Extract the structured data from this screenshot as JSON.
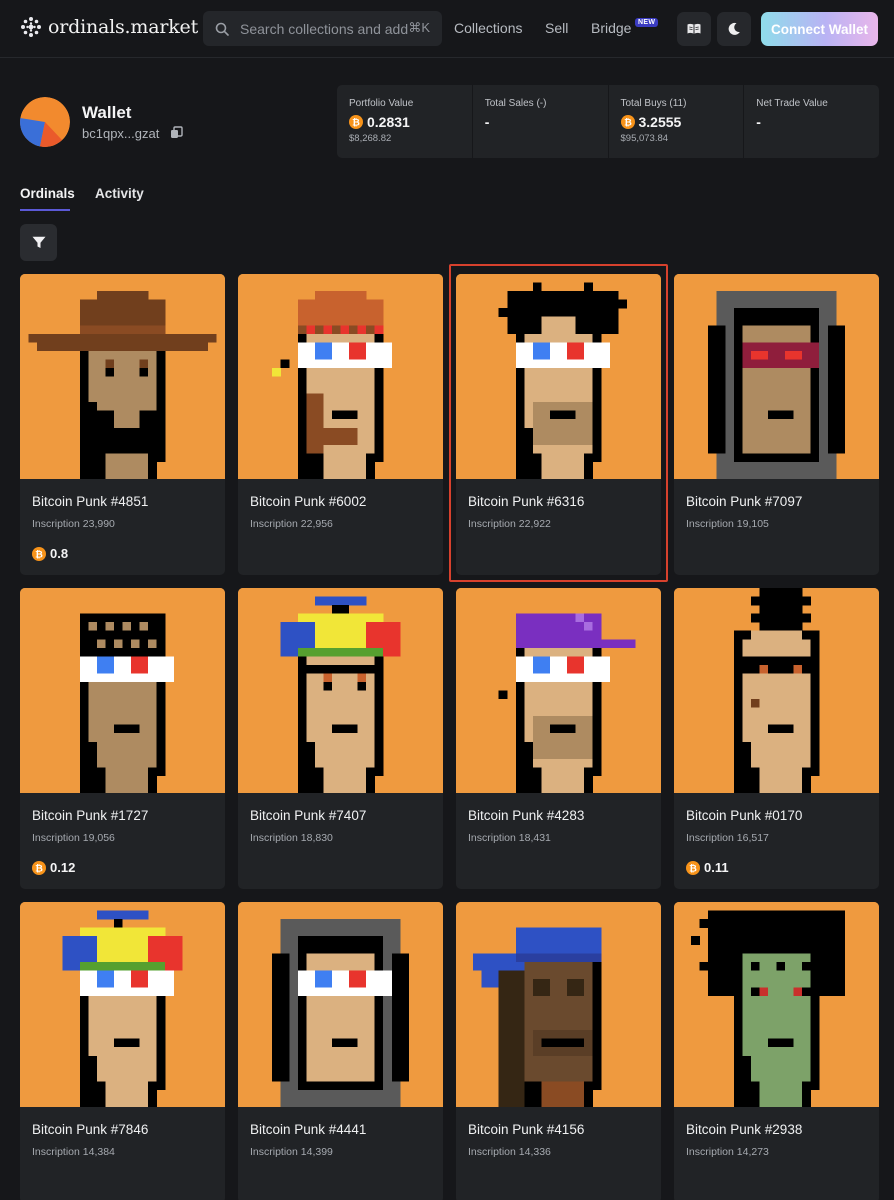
{
  "header": {
    "logo_text": "ordinals.market",
    "search_placeholder": "Search collections and addresses",
    "search_shortcut": "⌘K",
    "nav": [
      "Collections",
      "Sell",
      "Bridge"
    ],
    "bridge_badge": "NEW",
    "connect_label": "Connect Wallet"
  },
  "wallet": {
    "title": "Wallet",
    "address": "bc1qpx...gzat"
  },
  "stats": [
    {
      "label": "Portfolio Value",
      "value": "0.2831",
      "sub": "$8,268.82",
      "btc": true
    },
    {
      "label": "Total Sales (-)",
      "value": "-",
      "sub": "",
      "btc": false
    },
    {
      "label": "Total Buys (11)",
      "value": "3.2555",
      "sub": "$95,073.84",
      "btc": true
    },
    {
      "label": "Net Trade Value",
      "value": "-",
      "sub": "",
      "btc": false
    }
  ],
  "tabs": [
    "Ordinals",
    "Activity"
  ],
  "colors": {
    "accent": "#5b59d6",
    "card_bg": "#ef9a3f",
    "bitcoin": "#f7931a",
    "highlight": "#d7412d"
  },
  "cards": [
    {
      "name": "Bitcoin Punk #4851",
      "inscription": "Inscription 23,990",
      "price": "0.8",
      "icon": "punk-cowboy-hat-icon"
    },
    {
      "name": "Bitcoin Punk #6002",
      "inscription": "Inscription 22,956",
      "price": "",
      "icon": "punk-3d-glasses-red-hat-icon"
    },
    {
      "name": "Bitcoin Punk #6316",
      "inscription": "Inscription 22,922",
      "price": "",
      "icon": "punk-3d-glasses-messy-hair-icon"
    },
    {
      "name": "Bitcoin Punk #7097",
      "inscription": "Inscription 19,105",
      "price": "",
      "icon": "punk-hoodie-vr-icon"
    },
    {
      "name": "Bitcoin Punk #1727",
      "inscription": "Inscription 19,056",
      "price": "0.12",
      "icon": "punk-3d-glasses-hair-icon"
    },
    {
      "name": "Bitcoin Punk #7407",
      "inscription": "Inscription 18,830",
      "price": "",
      "icon": "punk-propeller-cap-icon"
    },
    {
      "name": "Bitcoin Punk #4283",
      "inscription": "Inscription 18,431",
      "price": "",
      "icon": "punk-purple-cap-icon"
    },
    {
      "name": "Bitcoin Punk #0170",
      "inscription": "Inscription 16,517",
      "price": "0.11",
      "icon": "punk-mohawk-icon"
    },
    {
      "name": "Bitcoin Punk #7846",
      "inscription": "Inscription 14,384",
      "price": "",
      "icon": "punk-propeller-3d-glasses-icon"
    },
    {
      "name": "Bitcoin Punk #4441",
      "inscription": "Inscription 14,399",
      "price": "",
      "icon": "punk-hoodie-3d-glasses-icon"
    },
    {
      "name": "Bitcoin Punk #4156",
      "inscription": "Inscription 14,336",
      "price": "",
      "icon": "punk-ape-bandana-icon"
    },
    {
      "name": "Bitcoin Punk #2938",
      "inscription": "Inscription 14,273",
      "price": "",
      "icon": "punk-zombie-icon"
    }
  ]
}
